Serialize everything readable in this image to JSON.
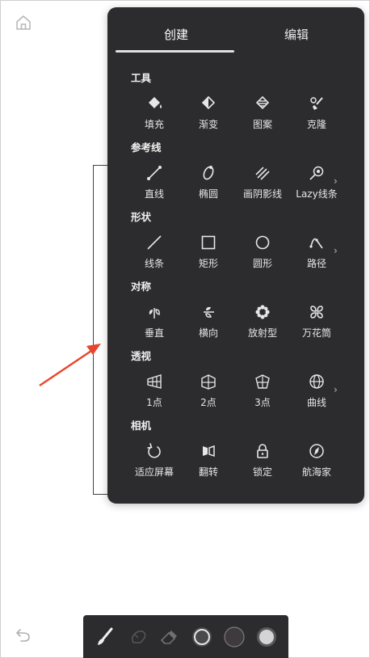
{
  "tabs": {
    "create": "创建",
    "edit": "编辑"
  },
  "sections": [
    {
      "title": "工具",
      "tools": [
        "填充",
        "渐变",
        "图案",
        "克隆"
      ],
      "has_more": false
    },
    {
      "title": "参考线",
      "tools": [
        "直线",
        "椭圆",
        "画阴影线",
        "Lazy线条"
      ],
      "has_more": true
    },
    {
      "title": "形状",
      "tools": [
        "线条",
        "矩形",
        "圆形",
        "路径"
      ],
      "has_more": true
    },
    {
      "title": "对称",
      "tools": [
        "垂直",
        "横向",
        "放射型",
        "万花筒"
      ],
      "has_more": false
    },
    {
      "title": "透视",
      "tools": [
        "1点",
        "2点",
        "3点",
        "曲线"
      ],
      "has_more": true
    },
    {
      "title": "相机",
      "tools": [
        "适应屏幕",
        "翻转",
        "锁定",
        "航海家"
      ],
      "has_more": false
    }
  ],
  "more_glyph": "›",
  "icons": {
    "home": "home-icon",
    "undo": "undo-icon",
    "bottom_bar": [
      "brush-icon",
      "smudge-icon",
      "eraser-icon",
      "brush-size-icon",
      "color-swatch-icon",
      "opacity-icon"
    ]
  },
  "colors": {
    "panel_bg": "#2c2c2e",
    "arrow": "#e8452c",
    "swatch": "#3f3a3d"
  }
}
